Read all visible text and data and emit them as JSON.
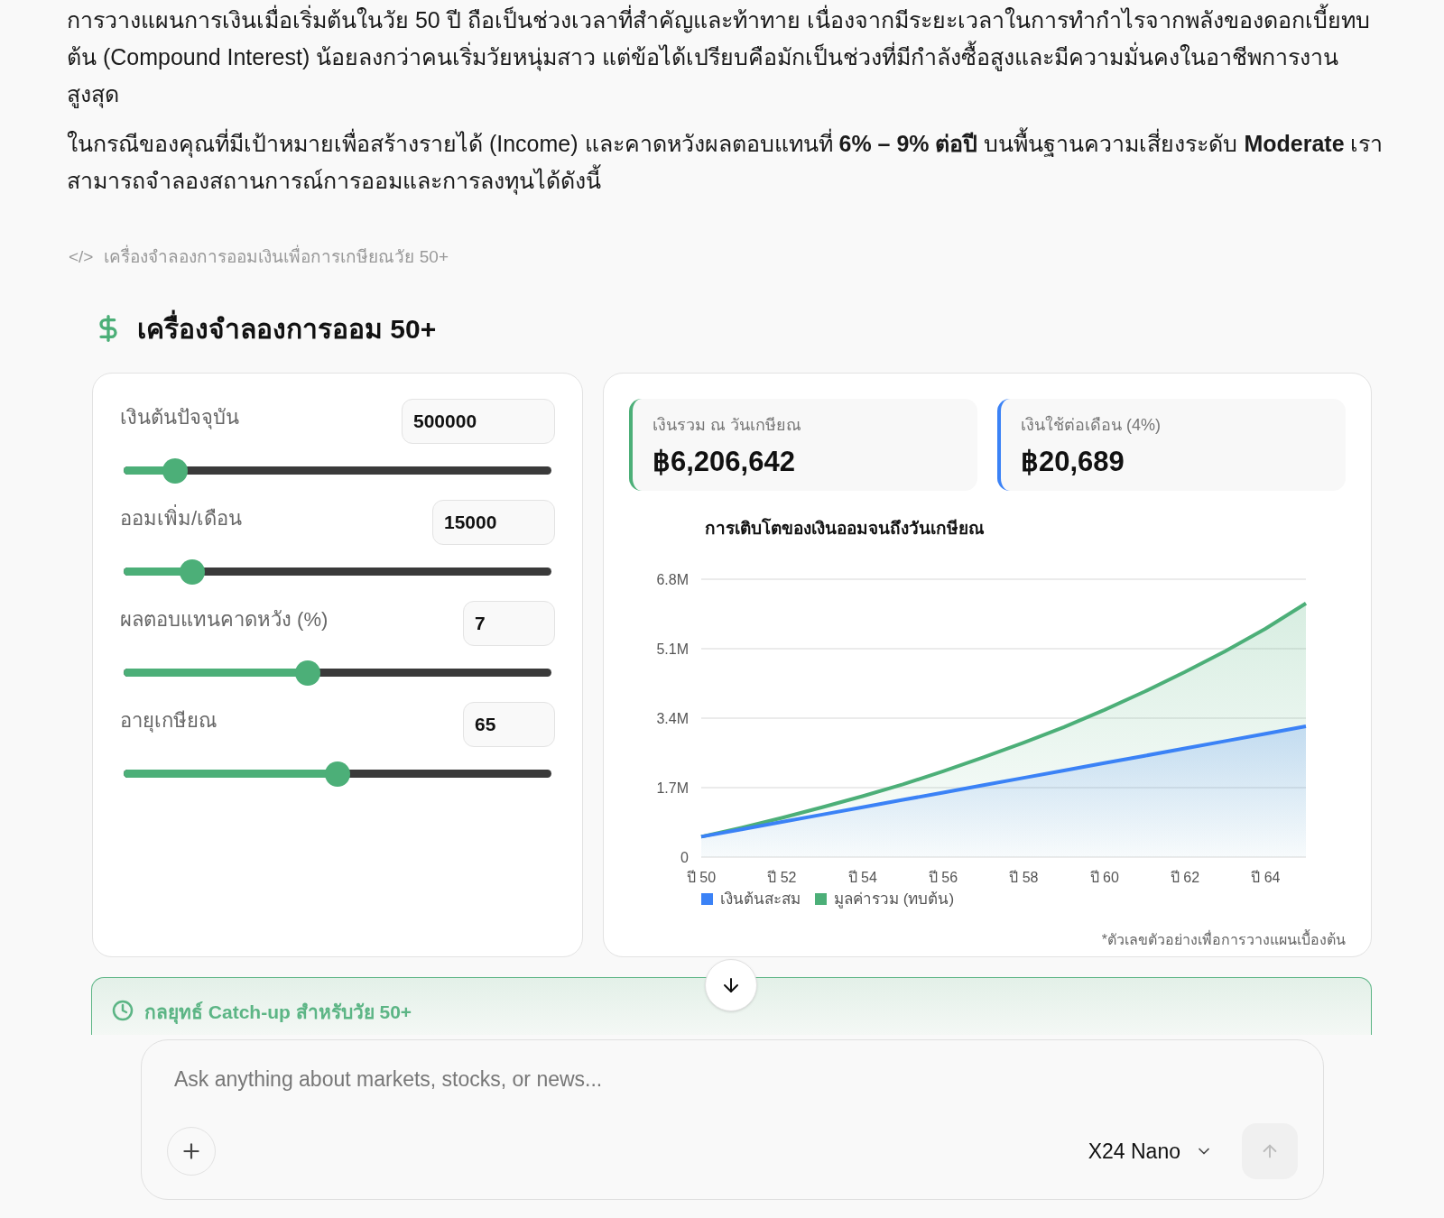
{
  "intro": {
    "paragraphs": [
      "การวางแผนการเงินเมื่อเริ่มต้นในวัย 50 ปี ถือเป็นช่วงเวลาที่สำคัญและท้าทาย เนื่องจากมีระยะเวลาในการทำกำไรจากพลังของดอกเบี้ยทบต้น (Compound Interest) น้อยลงกว่าคนเริ่มวัยหนุ่มสาว แต่ข้อได้เปรียบคือมักเป็นช่วงที่มีกำลังซื้อสูงและมีความมั่นคงในอาชีพการงานสูงสุด",
      "ในกรณีของคุณที่มีเป้าหมายเพื่อสร้างรายได้ (Income) และคาดหวังผลตอบแทนที่ **6% – 9% ต่อปี** บนพื้นฐานความเสี่ยงระดับ **Moderate** เราสามารถจำลองสถานการณ์การออมและการลงทุนได้ดังนี้"
    ]
  },
  "artifact_icon": "</>",
  "artifact_label": "เครื่องจำลองการออมเงินเพื่อการเกษียณวัย 50+",
  "simulator": {
    "title": "เครื่องจำลองการออม 50+",
    "inputs": [
      {
        "label": "เงินต้นปัจจุบัน",
        "value": "500000",
        "level": 0.12
      },
      {
        "label": "ออมเพิ่ม/เดือน",
        "value": "15000",
        "level": 0.16
      },
      {
        "label": "ผลตอบแทนคาดหวัง (%)",
        "value": "7",
        "level": 0.43
      },
      {
        "label": "อายุเกษียณ",
        "value": "65",
        "level": 0.5
      }
    ],
    "stats": [
      {
        "label": "เงินรวม ณ วันเกษียณ",
        "value": "฿6,206,642",
        "color": "#4caf78"
      },
      {
        "label": "เงินใช้ต่อเดือน (4%)",
        "value": "฿20,689",
        "color": "#3b82f6"
      }
    ],
    "chart_data": {
      "type": "area",
      "title": "การเติบโตของเงินออมจนถึงวันเกษียณ",
      "x": [
        50,
        51,
        52,
        53,
        54,
        55,
        56,
        57,
        58,
        59,
        60,
        61,
        62,
        63,
        64,
        65
      ],
      "series": [
        {
          "name": "เงินต้นสะสม",
          "color": "#3b82f6",
          "values": [
            500000,
            680000,
            860000,
            1040000,
            1220000,
            1400000,
            1580000,
            1760000,
            1940000,
            2120000,
            2300000,
            2480000,
            2660000,
            2840000,
            3020000,
            3200000
          ]
        },
        {
          "name": "มูลค่ารวม (ทบต้น)",
          "color": "#4caf78",
          "values": [
            500000,
            720000,
            960000,
            1220000,
            1490000,
            1780000,
            2100000,
            2440000,
            2800000,
            3180000,
            3600000,
            4050000,
            4530000,
            5040000,
            5590000,
            6210000
          ]
        }
      ],
      "xlim": [
        50,
        65
      ],
      "ylim": [
        0,
        6800000
      ],
      "grid": true,
      "legend": true,
      "yticks": [
        {
          "value": 0,
          "label": "0"
        },
        {
          "value": 1700000,
          "label": "1.7M"
        },
        {
          "value": 3400000,
          "label": "3.4M"
        },
        {
          "value": 5100000,
          "label": "5.1M"
        },
        {
          "value": 6800000,
          "label": "6.8M"
        }
      ],
      "xticks": [
        {
          "value": 50,
          "label": "ปี 50"
        },
        {
          "value": 52,
          "label": "ปี 52"
        },
        {
          "value": 54,
          "label": "ปี 54"
        },
        {
          "value": 56,
          "label": "ปี 56"
        },
        {
          "value": 58,
          "label": "ปี 58"
        },
        {
          "value": 60,
          "label": "ปี 60"
        },
        {
          "value": 62,
          "label": "ปี 62"
        },
        {
          "value": 64,
          "label": "ปี 64"
        }
      ]
    },
    "footnote": "*ตัวเลขตัวอย่างเพื่อการวางแผนเบื้องต้น",
    "next_section": "กลยุทธ์ Catch-up สำหรับวัย 50+"
  },
  "composer": {
    "placeholder": "Ask anything about markets, stocks, or news...",
    "model": "X24 Nano"
  }
}
